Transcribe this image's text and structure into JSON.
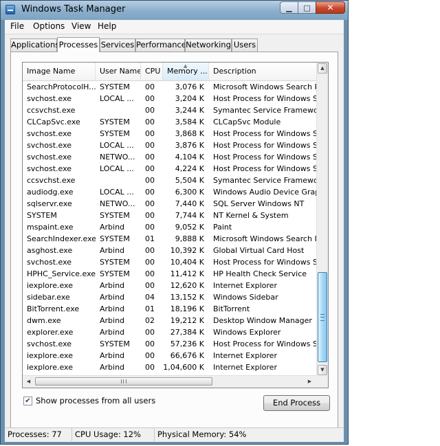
{
  "window": {
    "title": "Windows Task Manager",
    "min_glyph": "▁",
    "max_glyph": "□",
    "close_glyph": "✕"
  },
  "menu": {
    "file": "File",
    "options": "Options",
    "view": "View",
    "help": "Help"
  },
  "tabs": [
    {
      "label": "Applications"
    },
    {
      "label": "Processes"
    },
    {
      "label": "Services"
    },
    {
      "label": "Performance"
    },
    {
      "label": "Networking"
    },
    {
      "label": "Users"
    }
  ],
  "active_tab": "Processes",
  "columns": {
    "image_name": "Image Name",
    "user_name": "User Name",
    "cpu": "CPU",
    "memory": "Memory ...",
    "description": "Description"
  },
  "rows": [
    {
      "name": "SearchProtocolH...",
      "user": "SYSTEM",
      "cpu": "00",
      "mem": "3,076 K",
      "desc": "Microsoft Windows Search Proto"
    },
    {
      "name": "svchost.exe",
      "user": "LOCAL ...",
      "cpu": "00",
      "mem": "3,204 K",
      "desc": "Host Process for Windows Servi"
    },
    {
      "name": "ccsvchst.exe",
      "user": "",
      "cpu": "00",
      "mem": "3,244 K",
      "desc": "Symantec Service Framework"
    },
    {
      "name": "CLCapSvc.exe",
      "user": "SYSTEM",
      "cpu": "00",
      "mem": "3,584 K",
      "desc": "CLCapSvc Module"
    },
    {
      "name": "svchost.exe",
      "user": "SYSTEM",
      "cpu": "00",
      "mem": "3,868 K",
      "desc": "Host Process for Windows Servi"
    },
    {
      "name": "svchost.exe",
      "user": "LOCAL ...",
      "cpu": "00",
      "mem": "3,876 K",
      "desc": "Host Process for Windows Servi"
    },
    {
      "name": "svchost.exe",
      "user": "NETWO...",
      "cpu": "00",
      "mem": "4,104 K",
      "desc": "Host Process for Windows Servi"
    },
    {
      "name": "svchost.exe",
      "user": "LOCAL ...",
      "cpu": "00",
      "mem": "4,224 K",
      "desc": "Host Process for Windows Servi"
    },
    {
      "name": "ccsvchst.exe",
      "user": "",
      "cpu": "00",
      "mem": "5,504 K",
      "desc": "Symantec Service Framework"
    },
    {
      "name": "audiodg.exe",
      "user": "LOCAL ...",
      "cpu": "00",
      "mem": "6,300 K",
      "desc": "Windows Audio Device Graph Is"
    },
    {
      "name": "sqlservr.exe",
      "user": "NETWO...",
      "cpu": "00",
      "mem": "7,440 K",
      "desc": "SQL Server Windows NT"
    },
    {
      "name": "SYSTEM",
      "user": "SYSTEM",
      "cpu": "00",
      "mem": "7,744 K",
      "desc": "NT Kernel & System"
    },
    {
      "name": "mspaint.exe",
      "user": "Arbind",
      "cpu": "00",
      "mem": "9,052 K",
      "desc": "Paint"
    },
    {
      "name": "SearchIndexer.exe",
      "user": "SYSTEM",
      "cpu": "01",
      "mem": "9,888 K",
      "desc": "Microsoft Windows Search Inde"
    },
    {
      "name": "asghost.exe",
      "user": "Arbind",
      "cpu": "00",
      "mem": "10,392 K",
      "desc": "Global Virtual Card Host"
    },
    {
      "name": "svchost.exe",
      "user": "SYSTEM",
      "cpu": "00",
      "mem": "10,404 K",
      "desc": "Host Process for Windows Servi"
    },
    {
      "name": "HPHC_Service.exe",
      "user": "SYSTEM",
      "cpu": "00",
      "mem": "11,412 K",
      "desc": "HP Health Check Service"
    },
    {
      "name": "iexplore.exe",
      "user": "Arbind",
      "cpu": "00",
      "mem": "12,620 K",
      "desc": "Internet Explorer"
    },
    {
      "name": "sidebar.exe",
      "user": "Arbind",
      "cpu": "04",
      "mem": "13,152 K",
      "desc": "Windows Sidebar"
    },
    {
      "name": "BitTorrent.exe",
      "user": "Arbind",
      "cpu": "01",
      "mem": "18,196 K",
      "desc": "BitTorrent"
    },
    {
      "name": "dwm.exe",
      "user": "Arbind",
      "cpu": "02",
      "mem": "19,212 K",
      "desc": "Desktop Window Manager"
    },
    {
      "name": "explorer.exe",
      "user": "Arbind",
      "cpu": "00",
      "mem": "27,384 K",
      "desc": "Windows Explorer"
    },
    {
      "name": "svchost.exe",
      "user": "SYSTEM",
      "cpu": "00",
      "mem": "57,236 K",
      "desc": "Host Process for Windows Servi"
    },
    {
      "name": "iexplore.exe",
      "user": "Arbind",
      "cpu": "00",
      "mem": "66,676 K",
      "desc": "Internet Explorer"
    },
    {
      "name": "iexplore.exe",
      "user": "Arbind",
      "cpu": "00",
      "mem": "1,04,600 K",
      "desc": "Internet Explorer"
    }
  ],
  "show_all_users": {
    "label": "Show processes from all users",
    "checked": true,
    "check_glyph": "✔"
  },
  "end_process_label": "End Process",
  "status": {
    "processes": "Processes: 77",
    "cpu_usage": "CPU Usage: 12%",
    "physical_memory": "Physical Memory: 54%"
  },
  "glyphs": {
    "sort_up": "▲",
    "scroll_up": "▲",
    "scroll_down": "▼",
    "scroll_left": "◀",
    "scroll_right": "▶"
  }
}
